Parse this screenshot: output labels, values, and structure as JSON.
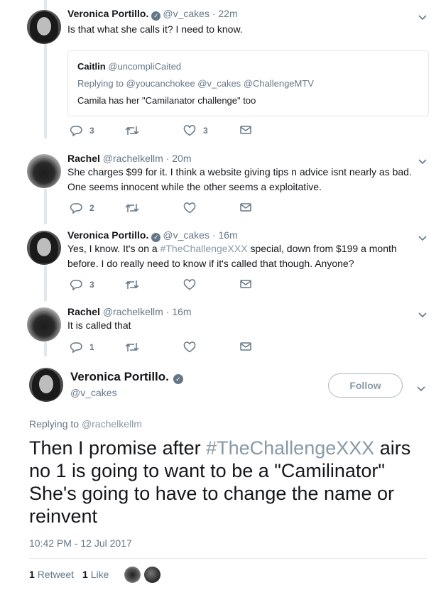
{
  "thread": [
    {
      "name": "Veronica Portillo.",
      "handle": "@v_cakes",
      "time": "· 22m",
      "text": "Is that what she calls it? I need to know.",
      "quote": {
        "name": "Caitlin",
        "handle": "@uncompliCaited",
        "replying": "Replying to @youcanchokee @v_cakes @ChallengeMTV",
        "text": "Camila has her \"Camilanator challenge\" too"
      },
      "reply_count": "3",
      "retweet_count": "",
      "like_count": "3"
    },
    {
      "name": "Rachel",
      "handle": "@rachelkellm",
      "time": "· 20m",
      "text_line1": "She charges $99 for it. I think a website giving tips n advice isnt nearly as bad.",
      "text_line2": "One seems innocent while the other seems a exploitative.",
      "reply_count": "2",
      "retweet_count": "",
      "like_count": ""
    },
    {
      "name": "Veronica Portillo.",
      "handle": "@v_cakes",
      "time": "· 16m",
      "text_pre": "Yes, I know. It's on a ",
      "hashtag": "#TheChallengeXXX",
      "text_post": " special, down from $199 a month",
      "text_line2": "before. I do really need to know if it's called that though. Anyone?",
      "reply_count": "3",
      "retweet_count": "",
      "like_count": ""
    },
    {
      "name": "Rachel",
      "handle": "@rachelkellm",
      "time": "· 16m",
      "text": "It is called that",
      "reply_count": "1",
      "retweet_count": "",
      "like_count": ""
    }
  ],
  "main": {
    "name": "Veronica Portillo.",
    "handle": "@v_cakes",
    "follow_label": "Follow",
    "replying_prefix": "Replying to ",
    "replying_to": "@rachelkellm",
    "text_pre": "Then I promise after ",
    "hashtag": "#TheChallengeXXX",
    "text_post": " airs no 1 is going to want to be a \"Camilinator\" She's going to have to change the name or reinvent",
    "timestamp": "10:42 PM - 12 Jul 2017",
    "retweets_count": "1",
    "retweets_label": "Retweet",
    "likes_count": "1",
    "likes_label": "Like"
  },
  "colors": {
    "text": "#14171a",
    "secondary": "#657786",
    "hashtag": "#8899a6",
    "border": "#e1e8ed"
  },
  "icons": [
    "reply-icon",
    "retweet-icon",
    "like-icon",
    "dm-icon",
    "chevron-down-icon",
    "verified-icon"
  ]
}
